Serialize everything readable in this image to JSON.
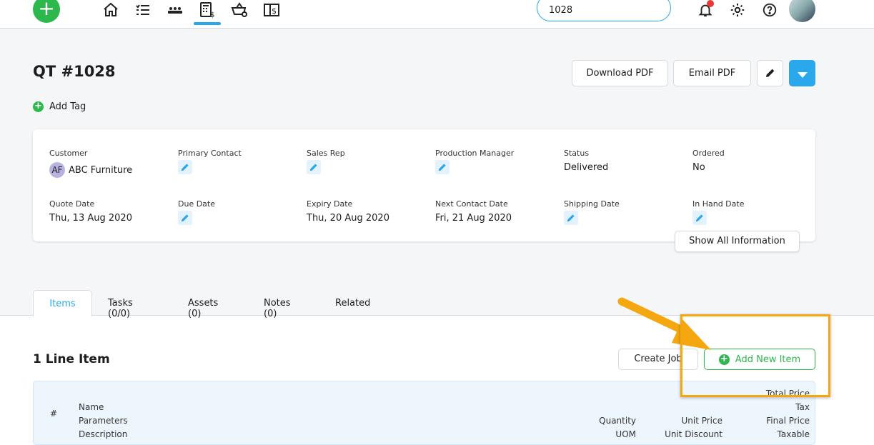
{
  "header": {
    "search_value": "1028",
    "nav_icons": [
      "home-icon",
      "tasks-icon",
      "production-icon",
      "quotes-icon",
      "orders-icon",
      "invoices-icon"
    ],
    "active_nav": "quotes-icon",
    "accent": "#2aa8ec"
  },
  "page": {
    "title": "QT #1028",
    "download_pdf": "Download PDF",
    "email_pdf": "Email PDF",
    "add_tag": "Add Tag"
  },
  "info": {
    "customer_label": "Customer",
    "customer_initials": "AF",
    "customer": "ABC Furniture",
    "primary_contact_label": "Primary Contact",
    "sales_rep_label": "Sales Rep",
    "production_manager_label": "Production Manager",
    "status_label": "Status",
    "status": "Delivered",
    "ordered_label": "Ordered",
    "ordered": "No",
    "quote_date_label": "Quote Date",
    "quote_date": "Thu, 13 Aug 2020",
    "due_date_label": "Due Date",
    "expiry_date_label": "Expiry Date",
    "expiry_date": "Thu, 20 Aug 2020",
    "next_contact_label": "Next Contact Date",
    "next_contact": "Fri, 21 Aug 2020",
    "shipping_date_label": "Shipping Date",
    "in_hand_label": "In Hand Date",
    "show_all": "Show All Information"
  },
  "tabs": [
    {
      "label": "Items"
    },
    {
      "label": "Tasks (0/0)"
    },
    {
      "label": "Assets (0)"
    },
    {
      "label": "Notes (0)"
    },
    {
      "label": "Related"
    }
  ],
  "items": {
    "title": "1 Line Item",
    "create_job": "Create Job",
    "add_new_item": "Add New Item",
    "columns": {
      "num": "#",
      "name": "Name",
      "parameters": "Parameters",
      "description": "Description",
      "quantity": "Quantity",
      "uom": "UOM",
      "unit_price": "Unit Price",
      "unit_discount": "Unit Discount",
      "total_price": "Total Price",
      "tax": "Tax",
      "final_price": "Final Price",
      "taxable": "Taxable"
    }
  },
  "annotation_color": "#f5a70f"
}
